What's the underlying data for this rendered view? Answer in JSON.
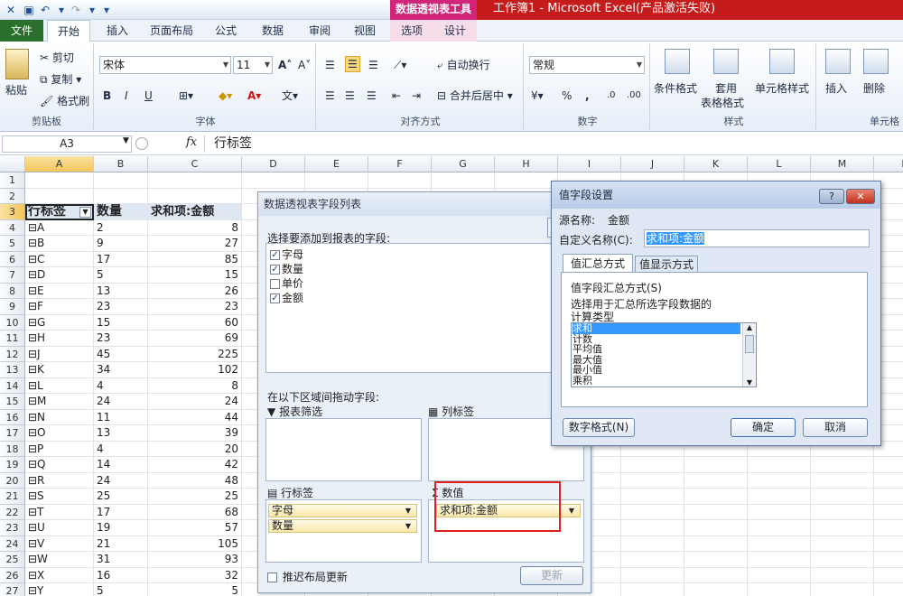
{
  "titlebar": {
    "pivot_tools": "数据透视表工具",
    "title": "工作簿1 - Microsoft Excel(产品激活失败)"
  },
  "tabs": [
    "文件",
    "开始",
    "插入",
    "页面布局",
    "公式",
    "数据",
    "审阅",
    "视图",
    "选项",
    "设计"
  ],
  "ribbon": {
    "clipboard": {
      "paste": "粘贴",
      "cut": "剪切",
      "copy": "复制 ▾",
      "format_painter": "格式刷",
      "label": "剪贴板"
    },
    "font": {
      "name": "宋体",
      "size": "11",
      "label": "字体",
      "bold": "B",
      "italic": "I",
      "underline": "U"
    },
    "alignment": {
      "wrap": "自动换行",
      "merge": "合并后居中 ▾",
      "label": "对齐方式"
    },
    "number": {
      "format": "常规",
      "label": "数字",
      "percent": "%",
      "comma": ","
    },
    "styles": {
      "cond": "条件格式",
      "table": "套用",
      "table2": "表格格式",
      "cell": "单元格样式",
      "label": "样式"
    },
    "cells": {
      "insert": "插入",
      "delete": "删除",
      "label": "单元格"
    }
  },
  "formula": {
    "namebox": "A3",
    "fx": "fx",
    "content": "行标签"
  },
  "columns": [
    "A",
    "B",
    "C",
    "D",
    "E",
    "F",
    "G",
    "H",
    "I",
    "J",
    "K",
    "L",
    "M",
    "N"
  ],
  "rows": [
    {
      "n": "1",
      "a": "",
      "b": "",
      "c": ""
    },
    {
      "n": "2",
      "a": "",
      "b": "",
      "c": ""
    },
    {
      "n": "3",
      "a": "行标签",
      "b": "数量",
      "c": "求和项:金额"
    },
    {
      "n": "4",
      "a": "⊟A",
      "b": "2",
      "c": "8"
    },
    {
      "n": "5",
      "a": "⊟B",
      "b": "9",
      "c": "27"
    },
    {
      "n": "6",
      "a": "⊟C",
      "b": "17",
      "c": "85"
    },
    {
      "n": "7",
      "a": "⊟D",
      "b": "5",
      "c": "15"
    },
    {
      "n": "8",
      "a": "⊟E",
      "b": "13",
      "c": "26"
    },
    {
      "n": "9",
      "a": "⊟F",
      "b": "23",
      "c": "23"
    },
    {
      "n": "10",
      "a": "⊟G",
      "b": "15",
      "c": "60"
    },
    {
      "n": "11",
      "a": "⊟H",
      "b": "23",
      "c": "69"
    },
    {
      "n": "12",
      "a": "⊟J",
      "b": "45",
      "c": "225"
    },
    {
      "n": "13",
      "a": "⊟K",
      "b": "34",
      "c": "102"
    },
    {
      "n": "14",
      "a": "⊟L",
      "b": "4",
      "c": "8"
    },
    {
      "n": "15",
      "a": "⊟M",
      "b": "24",
      "c": "24"
    },
    {
      "n": "16",
      "a": "⊟N",
      "b": "11",
      "c": "44"
    },
    {
      "n": "17",
      "a": "⊟O",
      "b": "13",
      "c": "39"
    },
    {
      "n": "18",
      "a": "⊟P",
      "b": "4",
      "c": "20"
    },
    {
      "n": "19",
      "a": "⊟Q",
      "b": "14",
      "c": "42"
    },
    {
      "n": "20",
      "a": "⊟R",
      "b": "24",
      "c": "48"
    },
    {
      "n": "21",
      "a": "⊟S",
      "b": "25",
      "c": "25"
    },
    {
      "n": "22",
      "a": "⊟T",
      "b": "17",
      "c": "68"
    },
    {
      "n": "23",
      "a": "⊟U",
      "b": "19",
      "c": "57"
    },
    {
      "n": "24",
      "a": "⊟V",
      "b": "21",
      "c": "105"
    },
    {
      "n": "25",
      "a": "⊟W",
      "b": "31",
      "c": "93"
    },
    {
      "n": "26",
      "a": "⊟X",
      "b": "16",
      "c": "32"
    },
    {
      "n": "27",
      "a": "⊟Y",
      "b": "5",
      "c": "5"
    }
  ],
  "pivot": {
    "title": "数据透视表字段列表",
    "choose": "选择要添加到报表的字段:",
    "fields": [
      {
        "name": "字母",
        "checked": "✓"
      },
      {
        "name": "数量",
        "checked": "✓"
      },
      {
        "name": "单价",
        "checked": ""
      },
      {
        "name": "金额",
        "checked": "✓"
      }
    ],
    "drag": "在以下区域间拖动字段:",
    "filter": "报表筛选",
    "columns": "列标签",
    "rows": "行标签",
    "values": "数值",
    "row_items": [
      "字母",
      "数量"
    ],
    "value_items": [
      "求和项:金额"
    ],
    "defer": "推迟布局更新",
    "update": "更新"
  },
  "dialog": {
    "title": "值字段设置",
    "help": "?",
    "close": "✕",
    "source_label": "源名称:",
    "source": "金额",
    "custom_label": "自定义名称(C):",
    "custom": "求和项:金额",
    "tab1": "值汇总方式",
    "tab2": "值显示方式",
    "summarize": "值字段汇总方式(S)",
    "desc1": "选择用于汇总所选字段数据的",
    "desc2": "计算类型",
    "list": [
      "求和",
      "计数",
      "平均值",
      "最大值",
      "最小值",
      "乘积"
    ],
    "numfmt": "数字格式(N)",
    "ok": "确定",
    "cancel": "取消"
  },
  "colors": {
    "pivot_tools": "#d1257a",
    "title_red": "#c61b1b",
    "file_tab": "#2a6f2c",
    "highlight_box": "#e02020",
    "selection": "#3399ff"
  }
}
